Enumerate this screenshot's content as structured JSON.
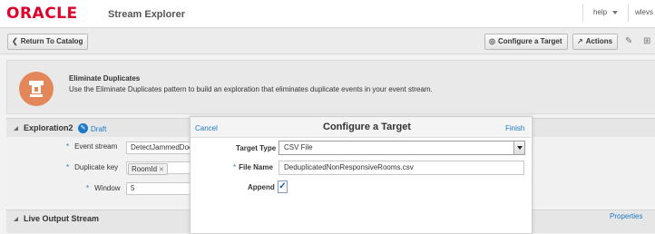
{
  "header": {
    "logo": "ORACLE",
    "app_title": "Stream Explorer",
    "help": "help",
    "user": "wlevs"
  },
  "toolbar": {
    "return_label": "Return To Catalog",
    "configure_target_label": "Configure a Target",
    "actions_label": "Actions"
  },
  "pattern": {
    "title": "Eliminate Duplicates",
    "description": "Use the Eliminate Duplicates pattern to build an exploration that eliminates duplicate events in your event stream."
  },
  "exploration": {
    "name": "Exploration2",
    "status": "Draft",
    "fields": {
      "event_stream_label": "Event stream",
      "event_stream_value": "DetectJammedDoor",
      "duplicate_key_label": "Duplicate key",
      "duplicate_key_token": "RoomId",
      "window_label": "Window",
      "window_value": "5"
    }
  },
  "live_output": {
    "title": "Live Output Stream",
    "properties_label": "Properties"
  },
  "dialog": {
    "title": "Configure a Target",
    "cancel_label": "Cancel",
    "finish_label": "Finish",
    "target_type_label": "Target Type",
    "target_type_value": "CSV File",
    "file_name_label": "File Name",
    "file_name_value": "DeduplicatedNonResponsiveRooms.csv",
    "append_label": "Append",
    "append_checked": true
  },
  "colors": {
    "oracle_red": "#e0002a",
    "link_blue": "#1b79c6",
    "pattern_orange": "#e3875b"
  },
  "icons": {
    "return": "chevron-left-icon",
    "configure_target": "target-icon",
    "actions": "external-arrow-icon",
    "pattern": "eliminate-duplicates-icon",
    "edit": "pencil-icon"
  }
}
